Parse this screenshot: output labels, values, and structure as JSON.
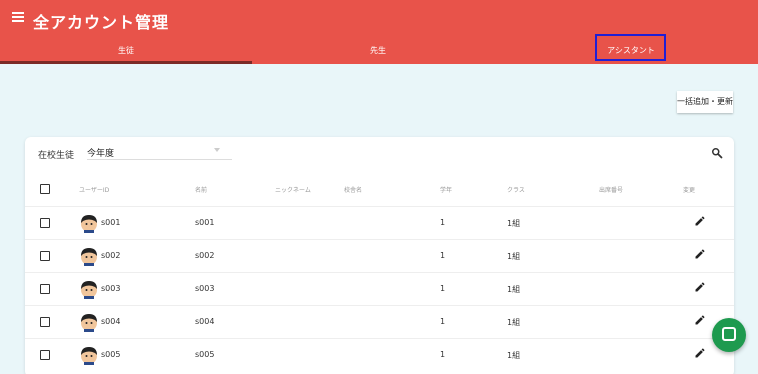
{
  "app": {
    "title": "全アカウント管理",
    "menu_icon": "hamburger-menu-icon"
  },
  "tabs": [
    {
      "label": "生徒",
      "active": true
    },
    {
      "label": "先生",
      "active": false
    },
    {
      "label": "アシスタント",
      "active": false,
      "highlighted": true
    }
  ],
  "colors": {
    "appbar": "#e8534a",
    "background": "#e9f6f9",
    "tab_indicator": "#7a2a27",
    "highlight": "#1f1fd6",
    "chat": "#1e9a4f"
  },
  "toolbar": {
    "bulk_button_label": "一括追加・更新"
  },
  "filter": {
    "label": "在校生徒",
    "year_value": "今年度",
    "search_icon": "search-icon"
  },
  "table": {
    "headers": [
      "ユーザーID",
      "名前",
      "ニックネーム",
      "校舎名",
      "学年",
      "クラス",
      "出席番号",
      "変更"
    ],
    "rows": [
      {
        "user_id": "s001",
        "name": "s001",
        "nickname": "",
        "school": "",
        "grade": "1",
        "class": "1組",
        "number": ""
      },
      {
        "user_id": "s002",
        "name": "s002",
        "nickname": "",
        "school": "",
        "grade": "1",
        "class": "1組",
        "number": ""
      },
      {
        "user_id": "s003",
        "name": "s003",
        "nickname": "",
        "school": "",
        "grade": "1",
        "class": "1組",
        "number": ""
      },
      {
        "user_id": "s004",
        "name": "s004",
        "nickname": "",
        "school": "",
        "grade": "1",
        "class": "1組",
        "number": ""
      },
      {
        "user_id": "s005",
        "name": "s005",
        "nickname": "",
        "school": "",
        "grade": "1",
        "class": "1組",
        "number": ""
      }
    ]
  },
  "chat": {
    "icon": "chat-icon"
  }
}
